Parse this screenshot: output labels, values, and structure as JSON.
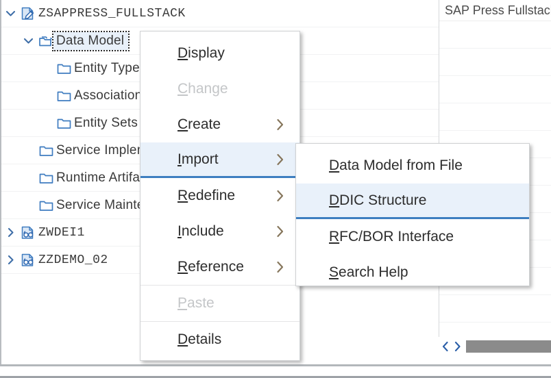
{
  "tree": {
    "rows": [
      {
        "label": "ZSAPPRESS_FULLSTACK",
        "indent": 0,
        "twisty": "chevron-down-icon",
        "icon": "project-document-icon",
        "style": "mono",
        "focused": false
      },
      {
        "label": "Data Model",
        "indent": 1,
        "twisty": "chevron-down-icon",
        "icon": "folder-open-icon",
        "style": "plain",
        "focused": true
      },
      {
        "label": "Entity Types",
        "indent": 2,
        "twisty": "none",
        "icon": "folder-icon",
        "style": "plain",
        "focused": false
      },
      {
        "label": "Associations",
        "indent": 2,
        "twisty": "none",
        "icon": "folder-icon",
        "style": "plain",
        "focused": false
      },
      {
        "label": "Entity Sets",
        "indent": 2,
        "twisty": "none",
        "icon": "folder-icon",
        "style": "plain",
        "focused": false
      },
      {
        "label": "Service Implementation",
        "indent": 1,
        "twisty": "none",
        "icon": "folder-icon",
        "style": "plain",
        "focused": false
      },
      {
        "label": "Runtime Artifacts",
        "indent": 1,
        "twisty": "none",
        "icon": "folder-icon",
        "style": "plain",
        "focused": false
      },
      {
        "label": "Service Maintenance",
        "indent": 1,
        "twisty": "none",
        "icon": "folder-icon",
        "style": "plain",
        "focused": false
      },
      {
        "label": "ZWDEI1",
        "indent": 0,
        "twisty": "chevron-right-icon",
        "icon": "service-document-icon",
        "style": "mono",
        "focused": false
      },
      {
        "label": "ZZDEMO_02",
        "indent": 0,
        "twisty": "chevron-right-icon",
        "icon": "service-document-icon",
        "style": "mono",
        "focused": false
      }
    ]
  },
  "detail": {
    "header": "SAP Press Fullstack",
    "empty_row_count": 12
  },
  "scrollbar": {
    "left_arrow": "‹",
    "right_arrow": "›"
  },
  "context_menu": {
    "items": [
      {
        "label": "Display",
        "mnemonic": "D",
        "state": "normal",
        "submenu": false,
        "separator_before": false
      },
      {
        "label": "Change",
        "mnemonic": "C",
        "state": "disabled",
        "submenu": false,
        "separator_before": false
      },
      {
        "label": "Create",
        "mnemonic": "C",
        "state": "normal",
        "submenu": true,
        "separator_before": false
      },
      {
        "label": "Import",
        "mnemonic": "I",
        "state": "highlighted",
        "submenu": true,
        "separator_before": false
      },
      {
        "label": "Redefine",
        "mnemonic": "R",
        "state": "normal",
        "submenu": true,
        "separator_before": false
      },
      {
        "label": "Include",
        "mnemonic": "I",
        "state": "normal",
        "submenu": true,
        "separator_before": false
      },
      {
        "label": "Reference",
        "mnemonic": "R",
        "state": "normal",
        "submenu": true,
        "separator_before": false
      },
      {
        "label": "Paste",
        "mnemonic": "P",
        "state": "disabled",
        "submenu": false,
        "separator_before": true
      },
      {
        "label": "Details",
        "mnemonic": "D",
        "state": "normal",
        "submenu": false,
        "separator_before": true
      }
    ]
  },
  "submenu": {
    "items": [
      {
        "label": "Data Model from File",
        "mnemonic": "D",
        "state": "normal"
      },
      {
        "label": "DDIC Structure",
        "mnemonic": "D",
        "state": "highlighted"
      },
      {
        "label": "RFC/BOR Interface",
        "mnemonic": "R",
        "state": "normal"
      },
      {
        "label": "Search Help",
        "mnemonic": "S",
        "state": "normal"
      }
    ]
  },
  "colors": {
    "highlight_bg": "#e9f1fa",
    "highlight_border": "#3d7ec0",
    "icon_blue": "#3f7cc0",
    "text": "#2d2d2d",
    "disabled_text": "#c4c6c8"
  }
}
